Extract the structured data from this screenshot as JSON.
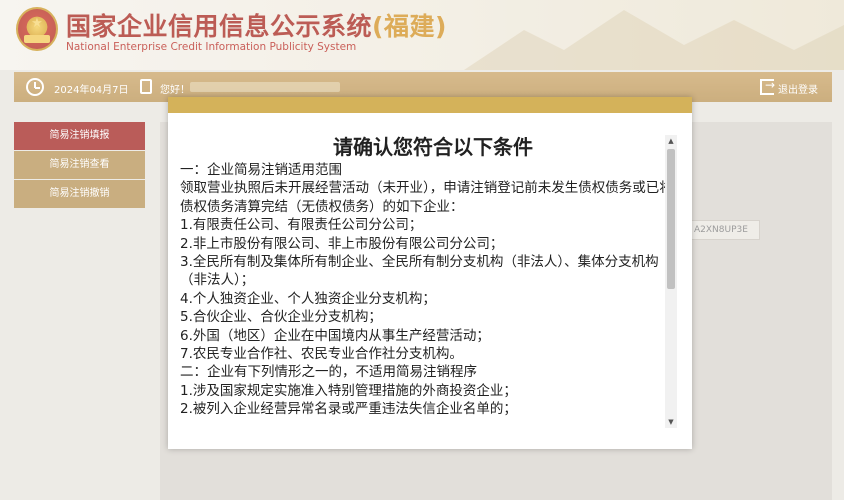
{
  "header": {
    "title_main": "国家企业信用信息公示系统",
    "title_region": "(福建)",
    "subtitle": "National Enterprise Credit Information Publicity System"
  },
  "topbar": {
    "date": "2024年04月7日",
    "greeting": "您好！",
    "logout": "退出登录"
  },
  "sidebar": {
    "items": [
      {
        "label": "简易注销填报",
        "active": true
      },
      {
        "label": "简易注销查看",
        "active": false
      },
      {
        "label": "简易注销撤销",
        "active": false
      }
    ]
  },
  "background": {
    "field_value": "A2XN8UP3E"
  },
  "modal": {
    "heading": "请确认您符合以下条件",
    "lines": [
      "一：企业简易注销适用范围",
      "领取营业执照后未开展经营活动（未开业），申请注销登记前未发生债权债务或已将债权债务清算完结（无债权债务）的如下企业：",
      "1.有限责任公司、有限责任公司分公司；",
      "2.非上市股份有限公司、非上市股份有限公司分公司；",
      "3.全民所有制及集体所有制企业、全民所有制分支机构（非法人）、集体分支机构（非法人）；",
      "4.个人独资企业、个人独资企业分支机构；",
      "5.合伙企业、合伙企业分支机构；",
      "6.外国（地区）企业在中国境内从事生产经营活动；",
      "7.农民专业合作社、农民专业合作社分支机构。",
      "二：企业有下列情形之一的，不适用简易注销程序",
      "1.涉及国家规定实施准入特别管理措施的外商投资企业；",
      "2.被列入企业经营异常名录或严重违法失信企业名单的；"
    ]
  },
  "colors": {
    "brand_red": "#a31e14",
    "gold": "#d4b25a",
    "topbar": "#c8a060"
  },
  "icons": {
    "clock": "clock-icon",
    "user": "user-card-icon",
    "logout": "logout-icon"
  }
}
